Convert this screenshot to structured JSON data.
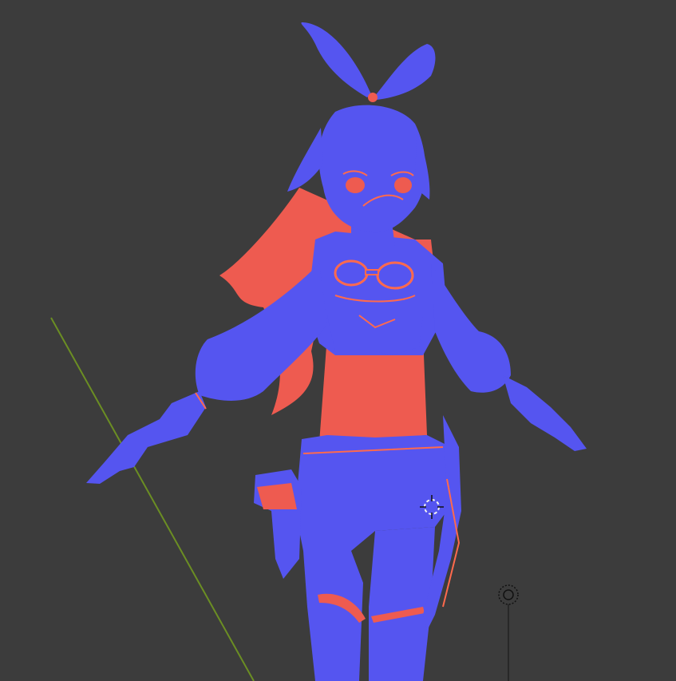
{
  "viewport": {
    "background": "#3c3c3c",
    "shading": {
      "front_faces": "#5555f0",
      "back_faces": "#ee5b50",
      "outline": "#ff6a4d"
    },
    "grid_axis_color": "#6b8e23"
  },
  "overlays": {
    "cursor_icon": "3d-cursor-icon",
    "light_icon": "light-icon"
  }
}
